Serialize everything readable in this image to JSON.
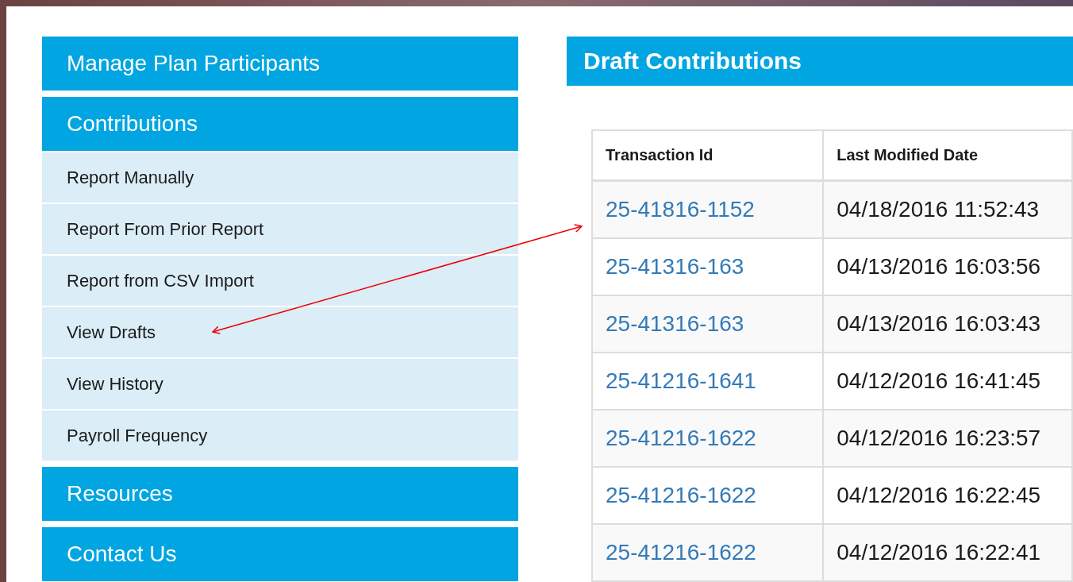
{
  "sidebar": [
    {
      "title": "Manage Plan Participants"
    },
    {
      "title": "Contributions",
      "items": [
        "Report Manually",
        "Report From Prior Report",
        "Report from CSV Import",
        "View Drafts",
        "View History",
        "Payroll Frequency"
      ]
    },
    {
      "title": "Resources"
    },
    {
      "title": "Contact Us"
    }
  ],
  "main": {
    "title": "Draft Contributions",
    "table": {
      "columns": [
        "Transaction Id",
        "Last Modified Date"
      ],
      "rows": [
        [
          "25-41816-1152",
          "04/18/2016 11:52:43"
        ],
        [
          "25-41316-163",
          "04/13/2016 16:03:56"
        ],
        [
          "25-41316-163",
          "04/13/2016 16:03:43"
        ],
        [
          "25-41216-1641",
          "04/12/2016 16:41:45"
        ],
        [
          "25-41216-1622",
          "04/12/2016 16:23:57"
        ],
        [
          "25-41216-1622",
          "04/12/2016 16:22:45"
        ],
        [
          "25-41216-1622",
          "04/12/2016 16:22:41"
        ]
      ]
    }
  }
}
